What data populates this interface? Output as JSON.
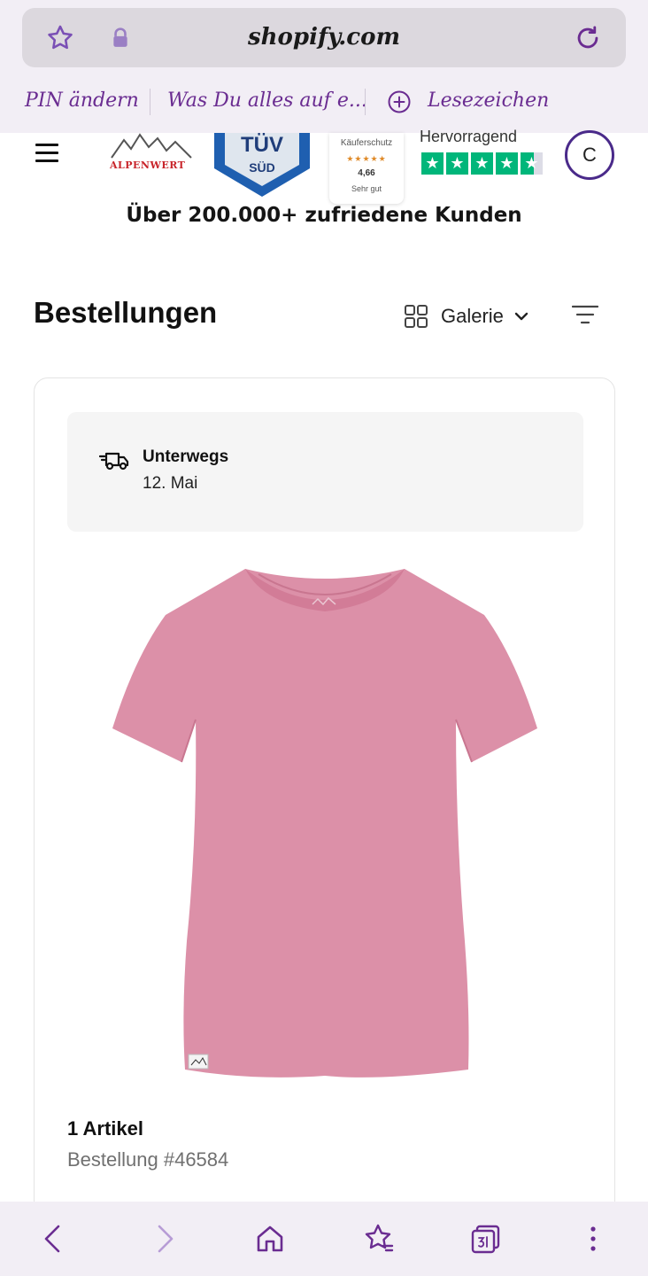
{
  "browser": {
    "url": "shopify.com",
    "bookmarks": [
      "PIN ändern",
      "Was Du alles auf e...",
      "Lesezeichen"
    ]
  },
  "header": {
    "trust": {
      "brand": "ALPENWERT",
      "tuv_top": "TÜV",
      "tuv_bottom": "SÜD",
      "kaeufer_label": "Käuferschutz",
      "kaeufer_stars": "★★★★★",
      "kaeufer_score": "4,66",
      "kaeufer_rating": "Sehr gut",
      "trustpilot_label": "Hervorragend"
    },
    "avatar_initial": "C",
    "customers_text": "Über 200.000+ zufriedene Kunden"
  },
  "orders": {
    "title": "Bestellungen",
    "view_label": "Galerie"
  },
  "order": {
    "status": "Unterwegs",
    "date": "12. Mai",
    "item_count": "1 Artikel",
    "order_number": "Bestellung #46584"
  },
  "colors": {
    "accent": "#6a2c91",
    "product": "#dc90a8",
    "trustpilot": "#00b67a",
    "chrome": "#f2eef5"
  },
  "icons": [
    "star-icon",
    "lock-icon",
    "reload-icon",
    "plus-circle-icon",
    "menu-icon",
    "grid-icon",
    "chevron-down-icon",
    "filter-icon",
    "truck-icon",
    "back-icon",
    "forward-icon",
    "home-icon",
    "bookmarks-icon",
    "tabs-icon",
    "more-icon"
  ]
}
